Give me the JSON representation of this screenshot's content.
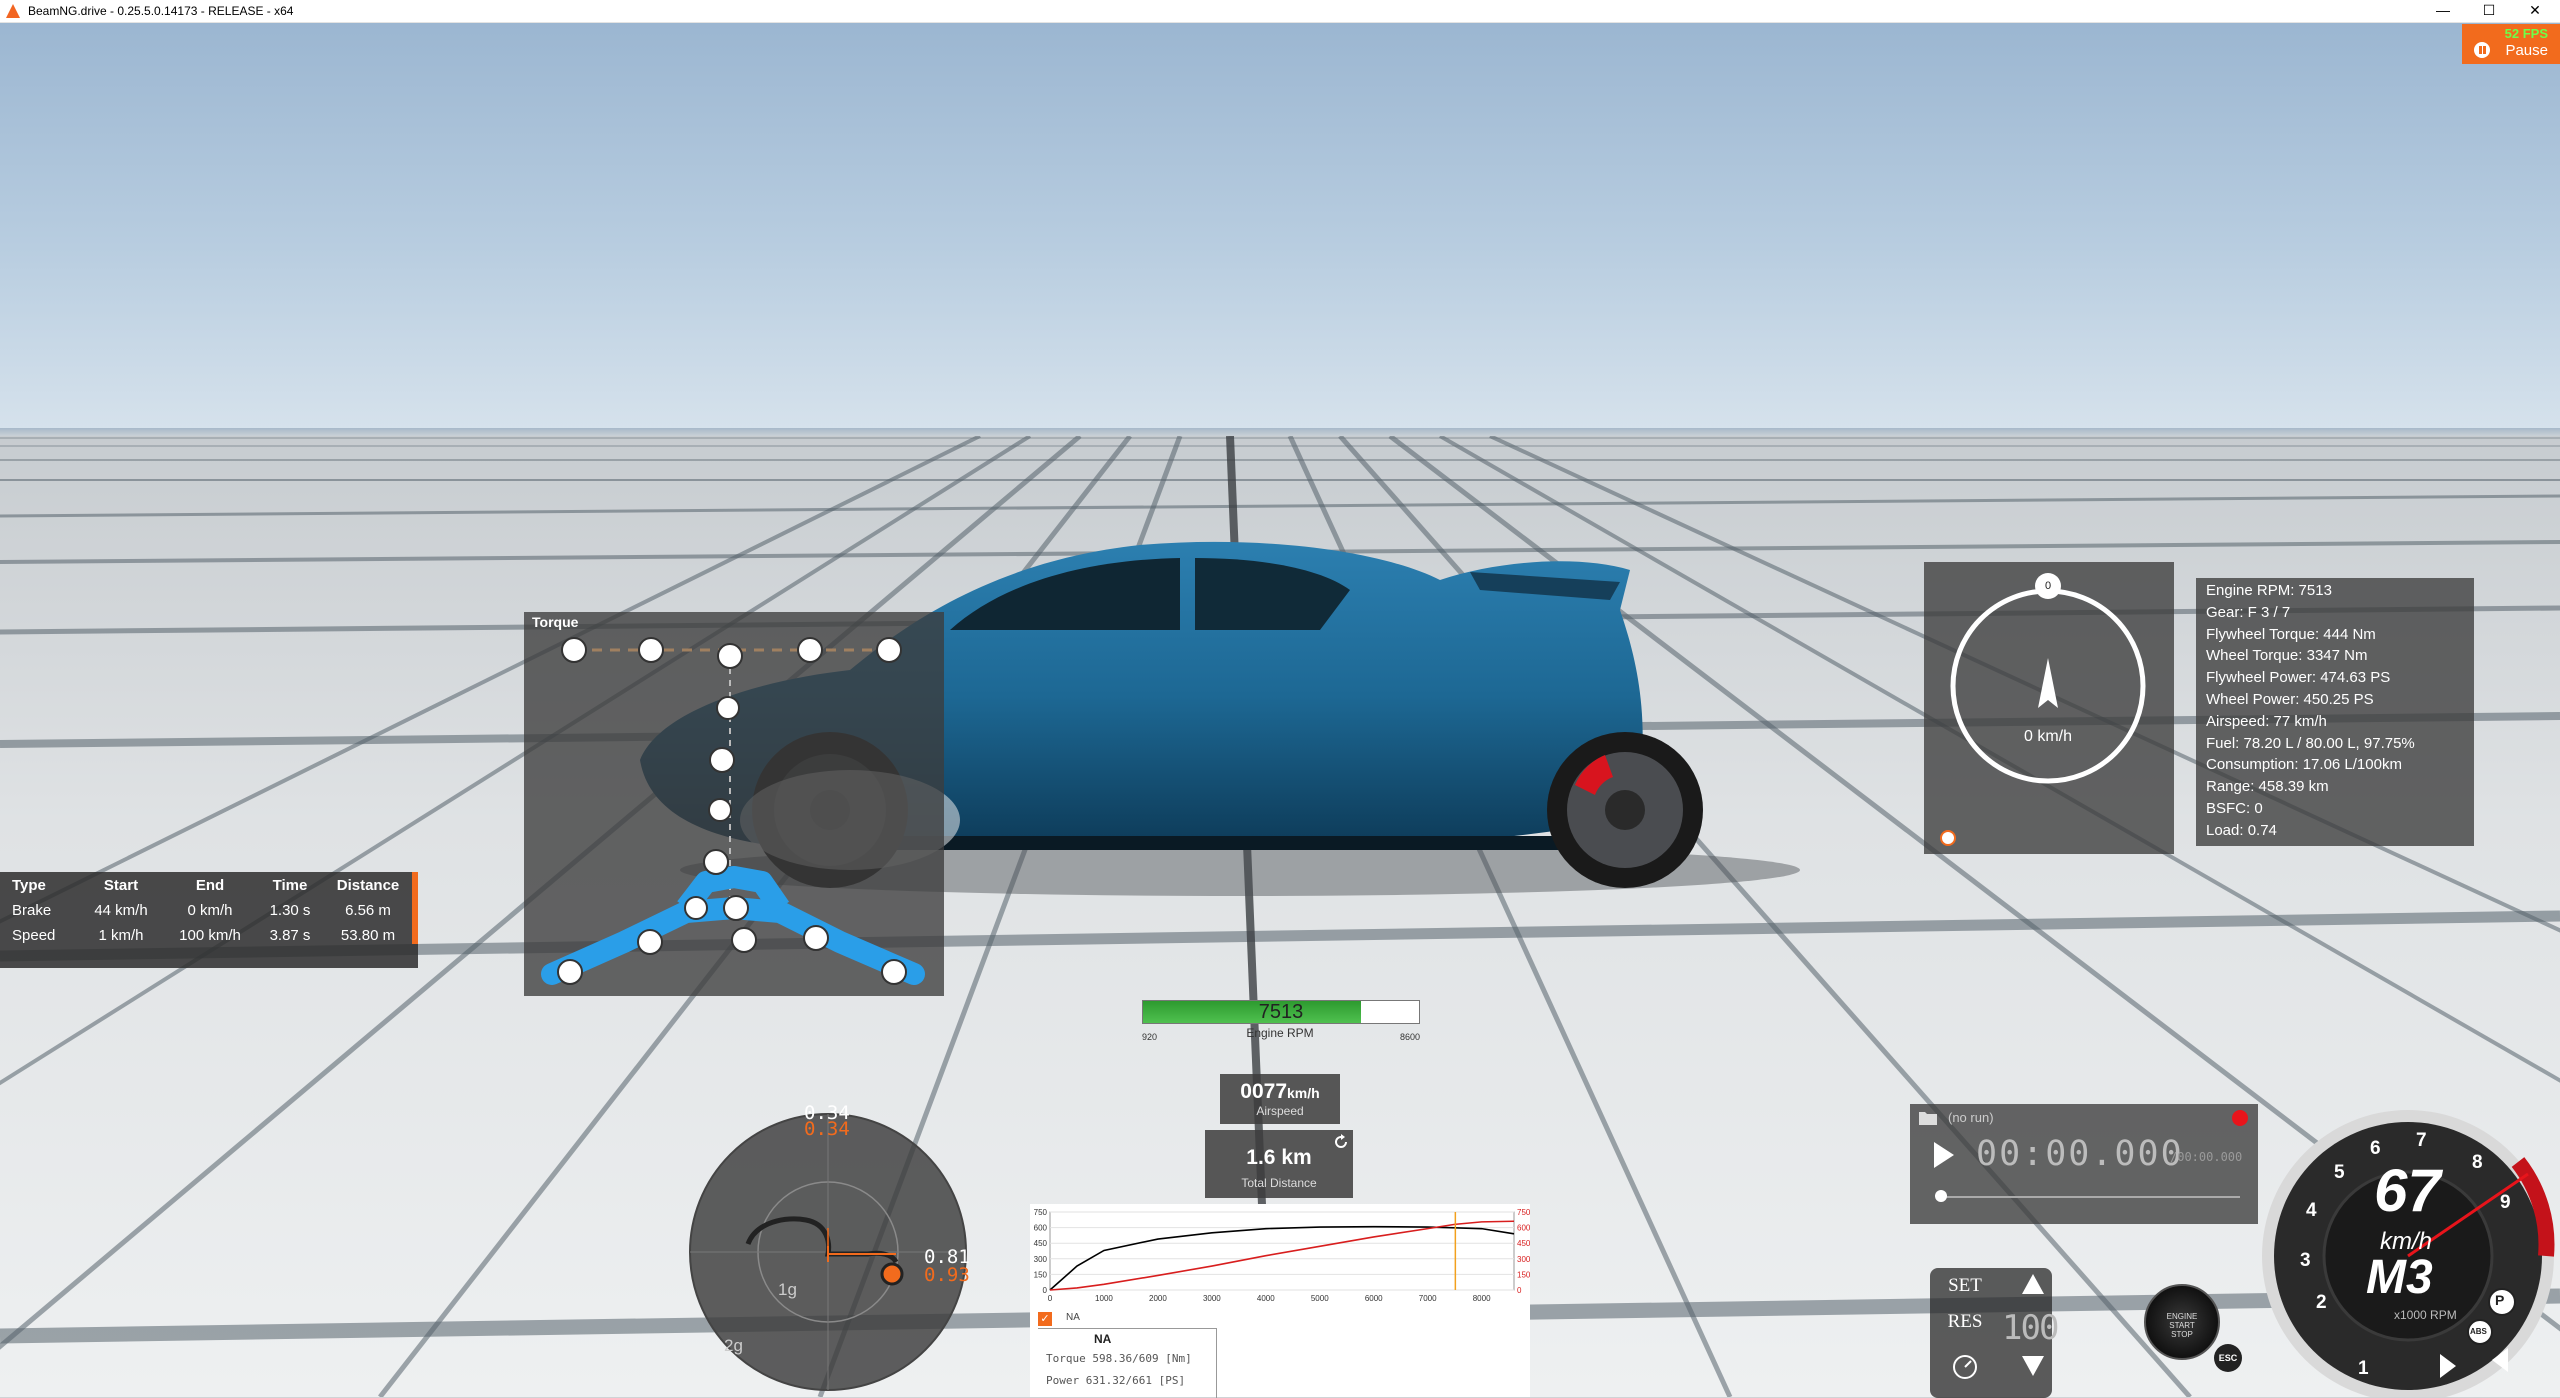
{
  "window": {
    "title": "BeamNG.drive - 0.25.5.0.14173 - RELEASE - x64",
    "minimize": "—",
    "maximize": "☐",
    "close": "✕"
  },
  "pause": {
    "fps": "52 FPS",
    "label": "Pause"
  },
  "measure": {
    "headers": [
      "Type",
      "Start",
      "End",
      "Time",
      "Distance"
    ],
    "rows": [
      [
        "Brake",
        "44 km/h",
        "0 km/h",
        "1.30 s",
        "6.56 m"
      ],
      [
        "Speed",
        "1 km/h",
        "100 km/h",
        "3.87 s",
        "53.80 m"
      ]
    ]
  },
  "torque_panel": {
    "title": "Torque"
  },
  "nav": {
    "heading_value": "0",
    "speed": "0 km/h"
  },
  "info": [
    "Engine RPM: 7513",
    "Gear: F 3 / 7",
    "Flywheel Torque: 444 Nm",
    "Wheel Torque: 3347 Nm",
    "Flywheel Power: 474.63 PS",
    "Wheel Power: 450.25 PS",
    "Airspeed: 77 km/h",
    "Fuel: 78.20 L / 80.00 L, 97.75%",
    "Consumption: 17.06 L/100km",
    "Range: 458.39 km",
    "BSFC: 0",
    "Load: 0.74"
  ],
  "rpm": {
    "value": "7513",
    "label": "Engine RPM",
    "min": "920",
    "max": "8600",
    "fraction": 0.79
  },
  "airspeed": {
    "value": "0077",
    "unit": "km/h",
    "label": "Airspeed"
  },
  "distance": {
    "value": "1.6 km",
    "label": "Total Distance"
  },
  "gforce": {
    "top_white": "0.34",
    "top_orange": "0.34",
    "right_white": "0.81",
    "right_orange": "0.93",
    "ring1": "1g",
    "ring2": "2g"
  },
  "torque_graph": {
    "left_ticks": [
      "750",
      "600",
      "450",
      "300",
      "150",
      "0"
    ],
    "right_ticks": [
      "750",
      "600",
      "450",
      "300",
      "150",
      "0"
    ],
    "x_ticks": [
      "0",
      "1000",
      "2000",
      "3000",
      "4000",
      "5000",
      "6000",
      "7000",
      "8000"
    ],
    "checkbox_mark": "✓",
    "checkbox_label": "NA",
    "curve_name": "NA",
    "torque_line": "Torque 598.36/609 [Nm]",
    "power_line": "Power  631.32/661 [PS]"
  },
  "chart_data": {
    "type": "line",
    "title": "",
    "xlabel": "",
    "ylabel": "",
    "xlim": [
      0,
      8600
    ],
    "ylim": [
      0,
      750
    ],
    "x": [
      0,
      500,
      1000,
      2000,
      3000,
      4000,
      5000,
      6000,
      7000,
      7500,
      8000,
      8600
    ],
    "series": [
      {
        "name": "Torque",
        "values": [
          0,
          230,
          380,
          490,
          550,
          590,
          605,
          609,
          605,
          598,
          590,
          540
        ]
      },
      {
        "name": "Power",
        "values": [
          0,
          20,
          55,
          140,
          230,
          330,
          420,
          510,
          590,
          631,
          655,
          661
        ]
      }
    ],
    "marker_rpm": 7513
  },
  "timer": {
    "name": "(no run)",
    "time": "00:00.000",
    "sub": "/00:00.000"
  },
  "cruise": {
    "set": "SET",
    "res": "RES",
    "speed": "100"
  },
  "engine_button": {
    "line1": "ENGINE",
    "line2": "START",
    "line3": "STOP"
  },
  "esc": "ESC",
  "gauge": {
    "speed": "67",
    "unit": "km/h",
    "gear": "M3",
    "rpm_label": "x1000 RPM",
    "ticks": [
      "1",
      "2",
      "3",
      "4",
      "5",
      "6",
      "7",
      "8",
      "9"
    ],
    "abs": "ABS",
    "parking": "P"
  },
  "colors": {
    "accent": "#f26b1d",
    "torque_line": "#000000",
    "power_line": "#d81e1e",
    "diagram_blue": "#2a9ee8",
    "car_blue": "#1e6a96",
    "rpm_fill": "#3caa3c"
  }
}
